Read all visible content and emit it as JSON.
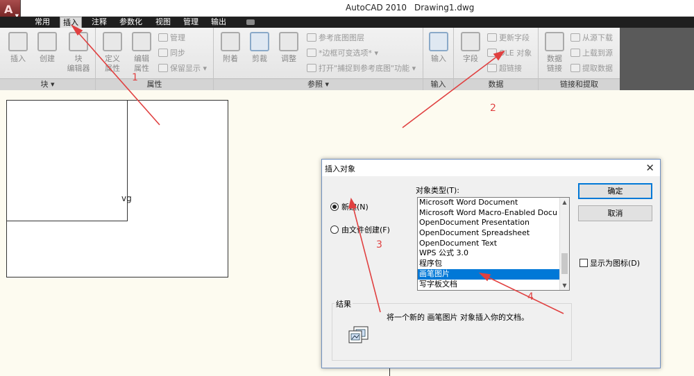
{
  "window": {
    "app_title": "AutoCAD 2010",
    "doc_title": "Drawing1.dwg"
  },
  "ribbon_tabs": [
    "常用",
    "插入",
    "注释",
    "参数化",
    "视图",
    "管理",
    "输出"
  ],
  "panels": {
    "block": {
      "title": "块",
      "buttons": [
        "插入",
        "创建",
        "块",
        "编辑器"
      ]
    },
    "attributes": {
      "title": "属性",
      "buttons": [
        "定义",
        "属性",
        "编辑",
        "属性"
      ],
      "small": [
        "管理",
        "同步",
        "保留显示"
      ]
    },
    "reference": {
      "title": "参照",
      "buttons": [
        "附着",
        "剪裁",
        "调整"
      ],
      "small": [
        "参考底图图层",
        "*边框可变选项*",
        "打开\"捕捉到参考底图\"功能"
      ]
    },
    "import": {
      "title": "输入",
      "buttons": [
        "输入"
      ]
    },
    "data": {
      "title": "数据",
      "buttons": [
        "字段"
      ],
      "small": [
        "更新字段",
        "OLE 对象",
        "超链接"
      ]
    },
    "linking": {
      "title": "链接和提取",
      "buttons": [
        "数据",
        "链接"
      ],
      "small": [
        "从源下载",
        "上载到源",
        "提取数据"
      ]
    }
  },
  "canvas": {
    "fragment_text": "vg"
  },
  "dialog": {
    "title": "插入对象",
    "radio_new": "新建(N)",
    "radio_file": "由文件创建(F)",
    "list_label": "对象类型(T):",
    "list_items": [
      "Microsoft Word Document",
      "Microsoft Word Macro-Enabled Docu",
      "OpenDocument Presentation",
      "OpenDocument Spreadsheet",
      "OpenDocument Text",
      "WPS 公式 3.0",
      "程序包",
      "画笔图片",
      "写字板文档"
    ],
    "selected_index": 7,
    "ok_label": "确定",
    "cancel_label": "取消",
    "checkbox_label": "显示为图标(D)",
    "result_label": "结果",
    "result_text": "将一个新的 画笔图片 对象插入你的文档。",
    "close_glyph": "✕"
  },
  "annotations": [
    "1",
    "2",
    "3",
    "4"
  ],
  "colors": {
    "annotation_red": "#e04040",
    "selection_blue": "#0078d7",
    "tab_bar": "#1f1f1f"
  }
}
